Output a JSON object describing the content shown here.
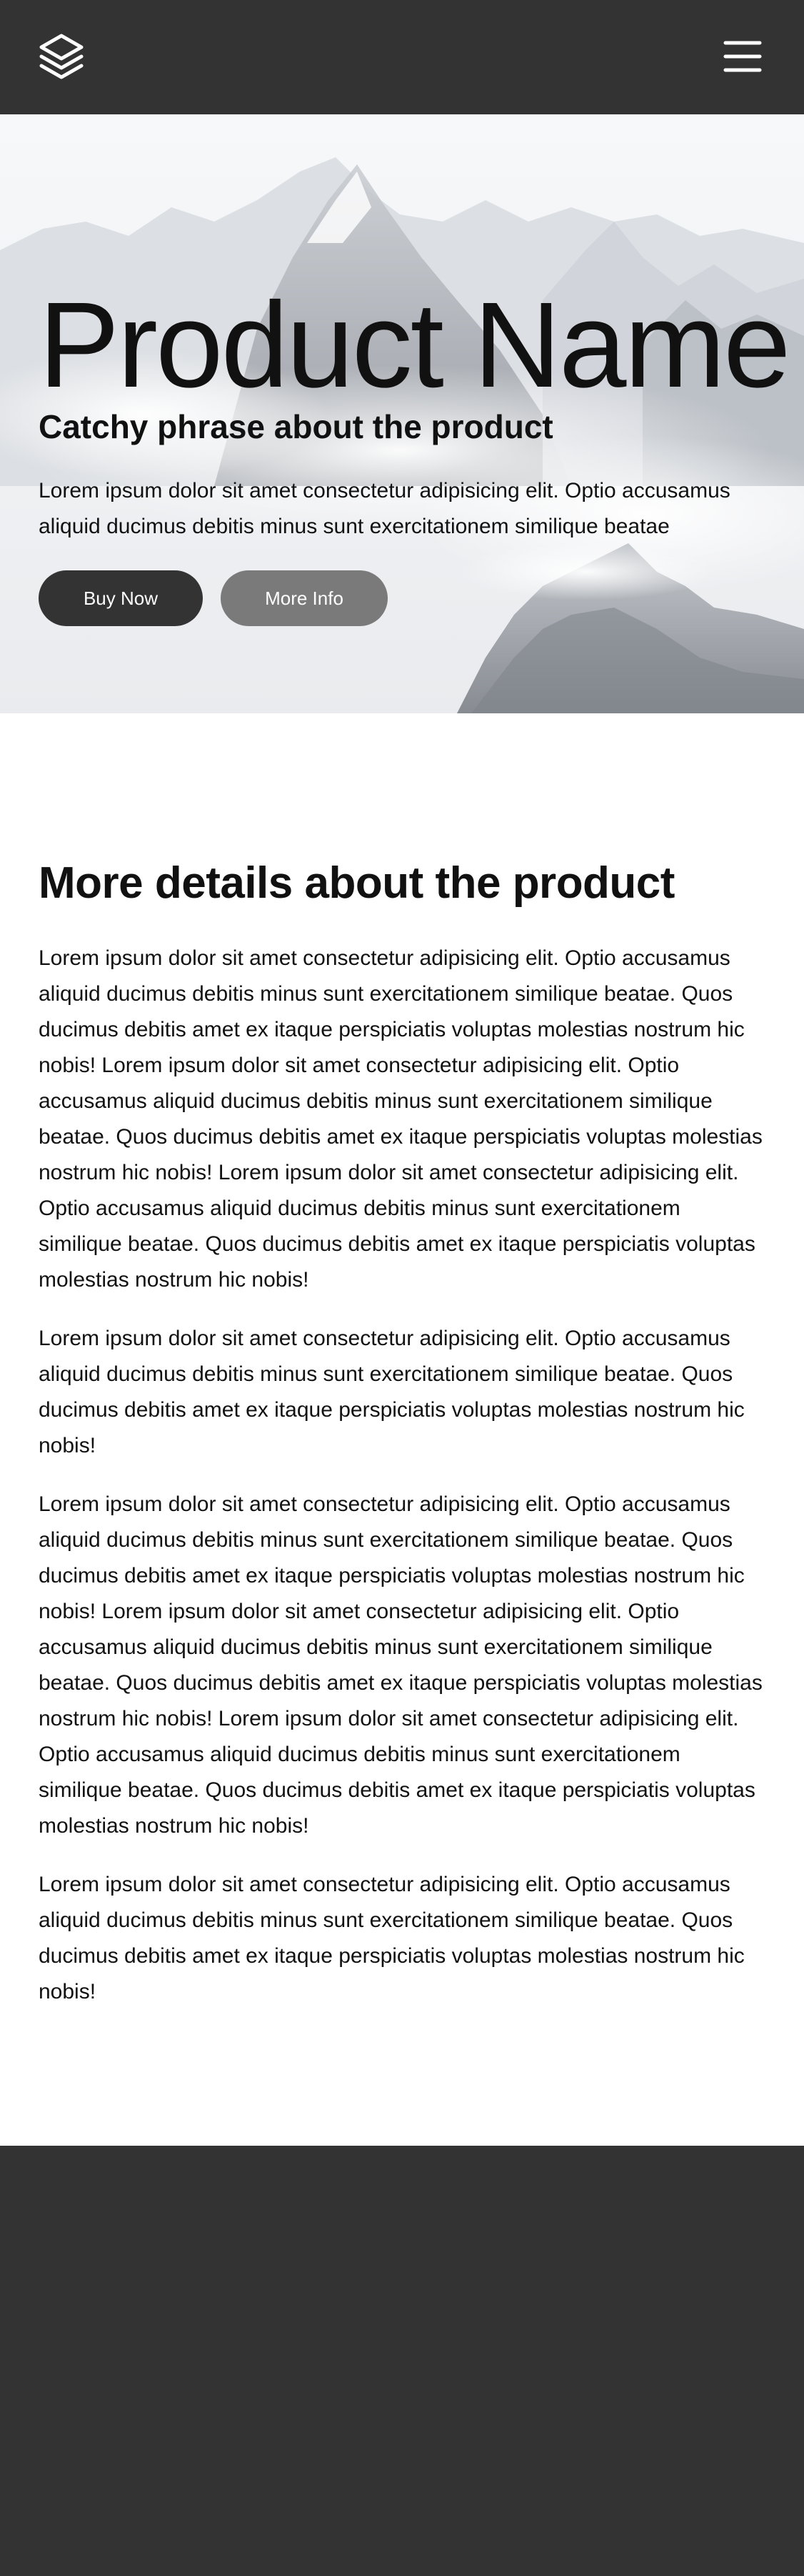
{
  "header": {
    "logo_icon": "layers-icon",
    "menu_icon": "hamburger-menu-icon",
    "background": "#333333"
  },
  "hero": {
    "title": "Product Name",
    "tagline": "Catchy phrase about the product",
    "description": "Lorem ipsum dolor sit amet consectetur adipisicing elit. Optio accusamus aliquid ducimus debitis minus sunt exercitationem similique beatae",
    "buy_label": "Buy Now",
    "info_label": "More Info",
    "buy_color": "#333333",
    "info_color": "#7a7a7a"
  },
  "details": {
    "heading": "More details about the product",
    "paragraphs": [
      "Lorem ipsum dolor sit amet consectetur adipisicing elit. Optio accusamus aliquid ducimus debitis minus sunt exercitationem similique beatae. Quos ducimus debitis amet ex itaque perspiciatis voluptas molestias nostrum hic nobis! Lorem ipsum dolor sit amet consectetur adipisicing elit. Optio accusamus aliquid ducimus debitis minus sunt exercitationem similique beatae. Quos ducimus debitis amet ex itaque perspiciatis voluptas molestias nostrum hic nobis! Lorem ipsum dolor sit amet consectetur adipisicing elit. Optio accusamus aliquid ducimus debitis minus sunt exercitationem similique beatae. Quos ducimus debitis amet ex itaque perspiciatis voluptas molestias nostrum hic nobis!",
      "Lorem ipsum dolor sit amet consectetur adipisicing elit. Optio accusamus aliquid ducimus debitis minus sunt exercitationem similique beatae. Quos ducimus debitis amet ex itaque perspiciatis voluptas molestias nostrum hic nobis!",
      "Lorem ipsum dolor sit amet consectetur adipisicing elit. Optio accusamus aliquid ducimus debitis minus sunt exercitationem similique beatae. Quos ducimus debitis amet ex itaque perspiciatis voluptas molestias nostrum hic nobis! Lorem ipsum dolor sit amet consectetur adipisicing elit. Optio accusamus aliquid ducimus debitis minus sunt exercitationem similique beatae. Quos ducimus debitis amet ex itaque perspiciatis voluptas molestias nostrum hic nobis! Lorem ipsum dolor sit amet consectetur adipisicing elit. Optio accusamus aliquid ducimus debitis minus sunt exercitationem similique beatae. Quos ducimus debitis amet ex itaque perspiciatis voluptas molestias nostrum hic nobis!",
      "Lorem ipsum dolor sit amet consectetur adipisicing elit. Optio accusamus aliquid ducimus debitis minus sunt exercitationem similique beatae. Quos ducimus debitis amet ex itaque perspiciatis voluptas molestias nostrum hic nobis!"
    ]
  },
  "footer": {
    "background": "#333333"
  }
}
